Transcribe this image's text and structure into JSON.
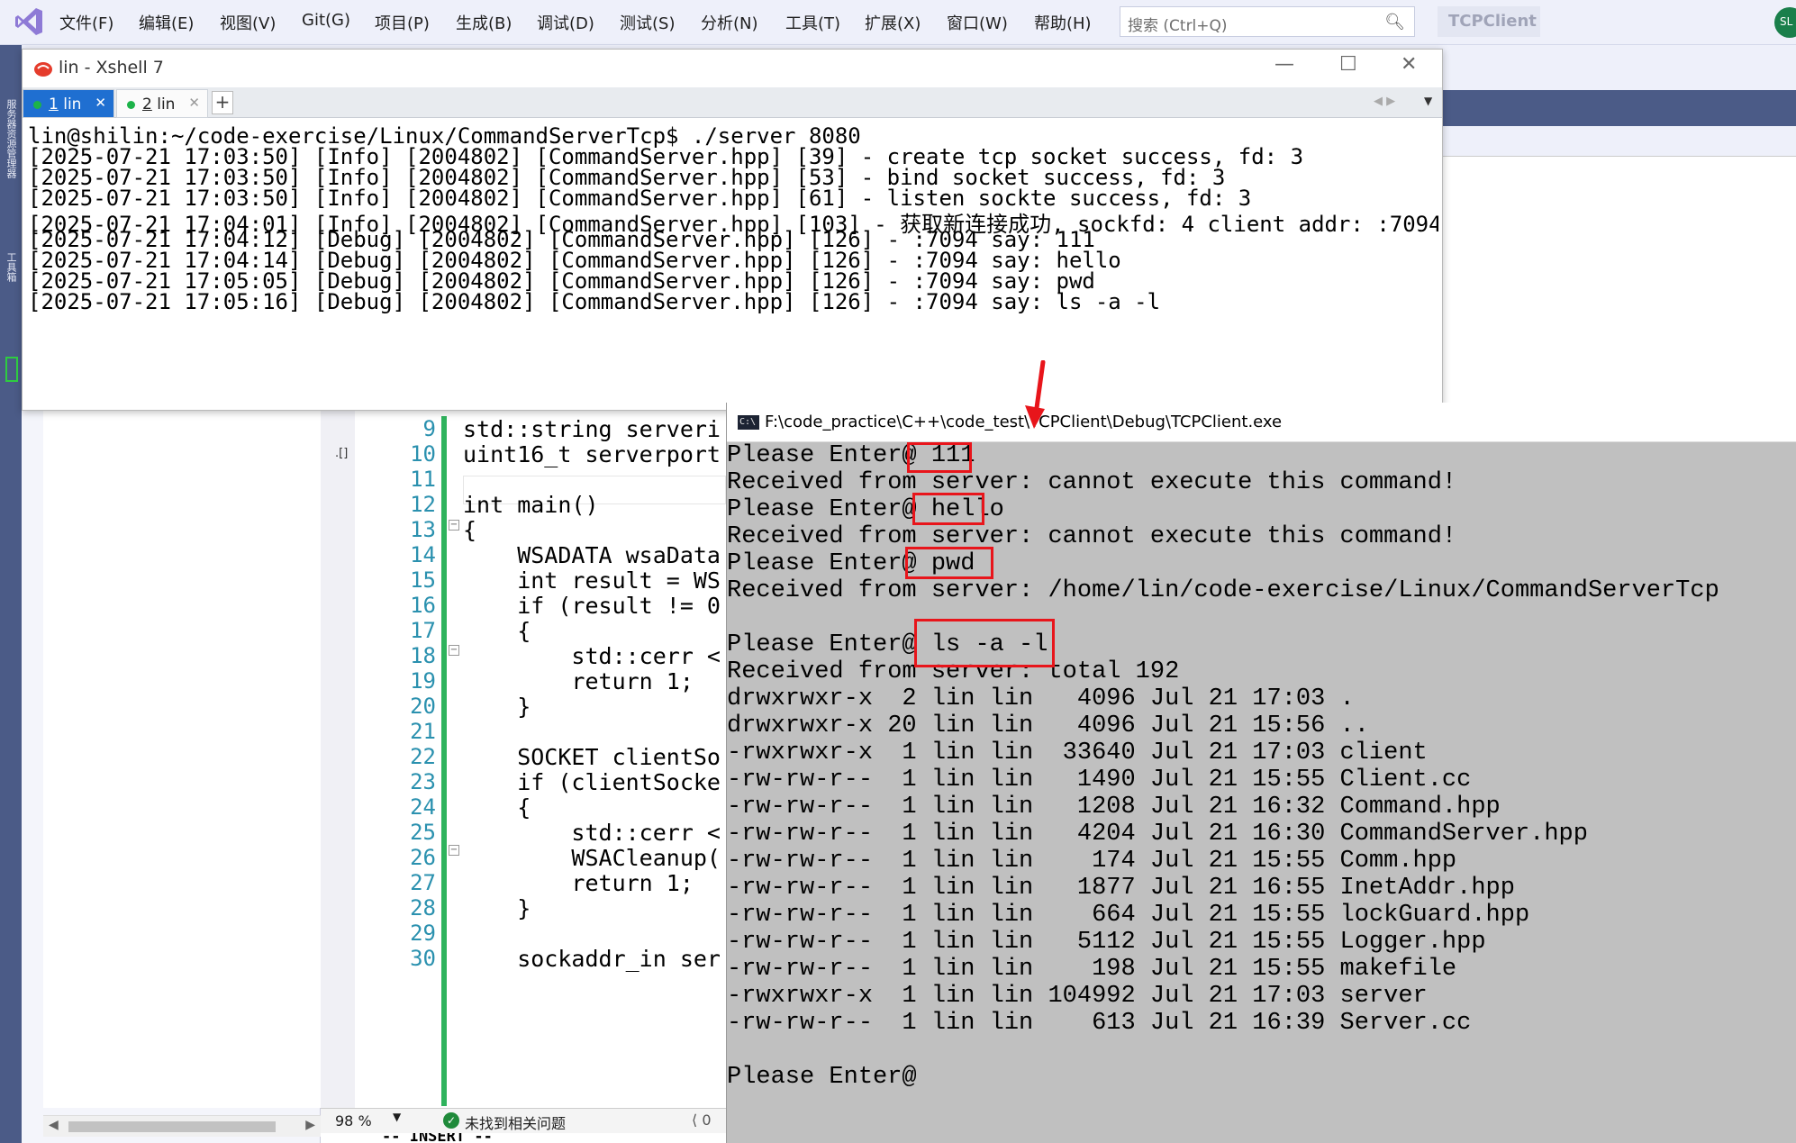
{
  "vs": {
    "menu": [
      {
        "label": "文件(F)"
      },
      {
        "label": "编辑(E)"
      },
      {
        "label": "视图(V)"
      },
      {
        "label": "Git(G)"
      },
      {
        "label": "项目(P)"
      },
      {
        "label": "生成(B)"
      },
      {
        "label": "调试(D)"
      },
      {
        "label": "测试(S)"
      },
      {
        "label": "分析(N)"
      },
      {
        "label": "工具(T)"
      },
      {
        "label": "扩展(X)"
      },
      {
        "label": "窗口(W)"
      },
      {
        "label": "帮助(H)"
      }
    ],
    "search_placeholder": "搜索 (Ctrl+Q)",
    "solution_name": "TCPClient",
    "avatar_initials": "SL",
    "left_strip_labels": [
      "服务器资源管理器",
      "工具箱"
    ],
    "editor_margin_mark": ".[]",
    "code_lines": [
      {
        "num": "9",
        "text": "std::string serveri"
      },
      {
        "num": "10",
        "text": "uint16_t serverport"
      },
      {
        "num": "11",
        "text": ""
      },
      {
        "num": "12",
        "text": "int main()"
      },
      {
        "num": "13",
        "text": "{"
      },
      {
        "num": "14",
        "text": "    WSADATA wsaData"
      },
      {
        "num": "15",
        "text": "    int result = WS"
      },
      {
        "num": "16",
        "text": "    if (result != 0"
      },
      {
        "num": "17",
        "text": "    {"
      },
      {
        "num": "18",
        "text": "        std::cerr <"
      },
      {
        "num": "19",
        "text": "        return 1;"
      },
      {
        "num": "20",
        "text": "    }"
      },
      {
        "num": "21",
        "text": ""
      },
      {
        "num": "22",
        "text": "    SOCKET clientSo"
      },
      {
        "num": "23",
        "text": "    if (clientSocke"
      },
      {
        "num": "24",
        "text": "    {"
      },
      {
        "num": "25",
        "text": "        std::cerr <"
      },
      {
        "num": "26",
        "text": "        WSACleanup("
      },
      {
        "num": "27",
        "text": "        return 1;"
      },
      {
        "num": "28",
        "text": "    }"
      },
      {
        "num": "29",
        "text": ""
      },
      {
        "num": "30",
        "text": "    sockaddr_in ser"
      }
    ],
    "status": {
      "zoom": "98 %",
      "issues": "未找到相关问题",
      "pen": "⟨ 0"
    },
    "insert_mode": "-- INSERT --"
  },
  "xshell": {
    "title": "lin - Xshell 7",
    "tabs": [
      {
        "num": "1",
        "label": "lin"
      },
      {
        "num": "2",
        "label": "lin"
      }
    ],
    "lines": [
      "lin@shilin:~/code-exercise/Linux/CommandServerTcp$ ./server 8080",
      "[2025-07-21 17:03:50] [Info] [2004802] [CommandServer.hpp] [39] - create tcp socket success, fd: 3",
      "[2025-07-21 17:03:50] [Info] [2004802] [CommandServer.hpp] [53] - bind socket success, fd: 3",
      "[2025-07-21 17:03:50] [Info] [2004802] [CommandServer.hpp] [61] - listen sockte success, fd: 3",
      "[2025-07-21 17:04:01] [Info] [2004802] [CommandServer.hpp] [103] - 获取新连接成功, sockfd: 4 client addr: :7094",
      "[2025-07-21 17:04:12] [Debug] [2004802] [CommandServer.hpp] [126] - :7094 say: 111",
      "[2025-07-21 17:04:14] [Debug] [2004802] [CommandServer.hpp] [126] - :7094 say: hello",
      "[2025-07-21 17:05:05] [Debug] [2004802] [CommandServer.hpp] [126] - :7094 say: pwd",
      "[2025-07-21 17:05:16] [Debug] [2004802] [CommandServer.hpp] [126] - :7094 say: ls -a -l"
    ]
  },
  "cmd": {
    "title": "F:\\code_practice\\C++\\code_test\\TCPClient\\Debug\\TCPClient.exe",
    "icon_text": "C:\\",
    "lines": [
      "Please Enter@ 111",
      "Received from server: cannot execute this command!",
      "Please Enter@ hello",
      "Received from server: cannot execute this command!",
      "Please Enter@ pwd",
      "Received from server: /home/lin/code-exercise/Linux/CommandServerTcp",
      "",
      "Please Enter@ ls -a -l",
      "Received from server: total 192",
      "drwxrwxr-x  2 lin lin   4096 Jul 21 17:03 .",
      "drwxrwxr-x 20 lin lin   4096 Jul 21 15:56 ..",
      "-rwxrwxr-x  1 lin lin  33640 Jul 21 17:03 client",
      "-rw-rw-r--  1 lin lin   1490 Jul 21 15:55 Client.cc",
      "-rw-rw-r--  1 lin lin   1208 Jul 21 16:32 Command.hpp",
      "-rw-rw-r--  1 lin lin   4204 Jul 21 16:30 CommandServer.hpp",
      "-rw-rw-r--  1 lin lin    174 Jul 21 15:55 Comm.hpp",
      "-rw-rw-r--  1 lin lin   1877 Jul 21 16:55 InetAddr.hpp",
      "-rw-rw-r--  1 lin lin    664 Jul 21 15:55 lockGuard.hpp",
      "-rw-rw-r--  1 lin lin   5112 Jul 21 15:55 Logger.hpp",
      "-rw-rw-r--  1 lin lin    198 Jul 21 15:55 makefile",
      "-rwxrwxr-x  1 lin lin 104992 Jul 21 17:03 server",
      "-rw-rw-r--  1 lin lin    613 Jul 21 16:39 Server.cc",
      "",
      "Please Enter@"
    ]
  },
  "colors": {
    "annotation_red": "#e8151b",
    "xshell_tab_active": "#1f6fd1",
    "cmd_bg": "#c0c0c0"
  }
}
